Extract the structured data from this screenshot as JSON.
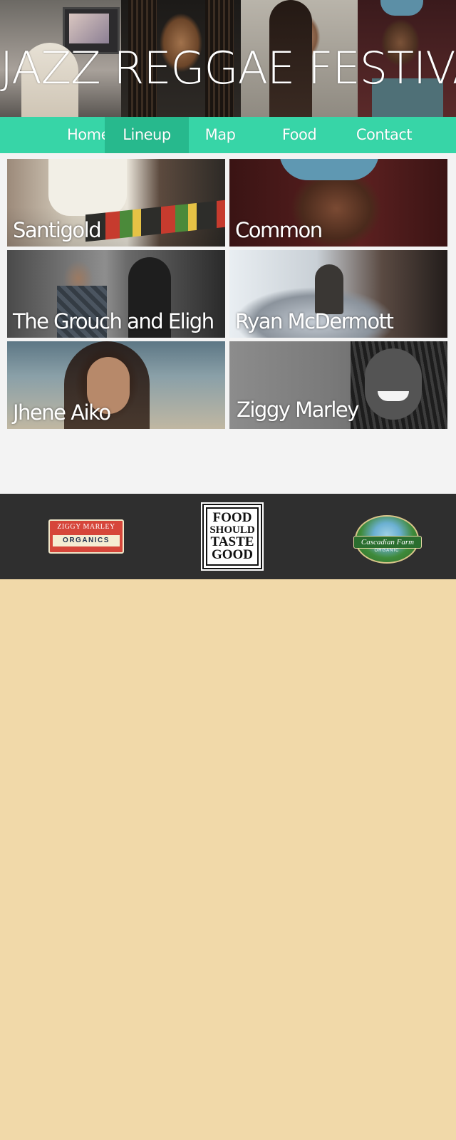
{
  "header": {
    "title": "JAZZ REGGAE FESTIVAL"
  },
  "nav": {
    "items": [
      {
        "label": "Home",
        "active": false
      },
      {
        "label": "Lineup",
        "active": true
      },
      {
        "label": "Map",
        "active": false
      },
      {
        "label": "Food",
        "active": false
      },
      {
        "label": "Contact",
        "active": false
      }
    ]
  },
  "lineup": {
    "artists": [
      {
        "name": "Santigold"
      },
      {
        "name": "Common"
      },
      {
        "name": "The Grouch and Eligh"
      },
      {
        "name": "Ryan McDermott"
      },
      {
        "name": "Jhene Aiko"
      },
      {
        "name": "Ziggy Marley"
      }
    ]
  },
  "sponsors": {
    "ziggy": {
      "line1": "ZIGGY MARLEY",
      "line2": "ORGANICS"
    },
    "food": {
      "line1": "FOOD",
      "line2": "SHOULD",
      "line3": "TASTE",
      "line4": "GOOD"
    },
    "cascadian": {
      "name": "Cascadian Farm",
      "sub": "ORGANIC"
    }
  },
  "colors": {
    "nav": "#37d5a7",
    "nav_active": "#27b98d",
    "lineup_bg": "#f3f3f3",
    "sponsors_bg": "#2f2f2f",
    "page_bg": "#f1d9a9"
  }
}
